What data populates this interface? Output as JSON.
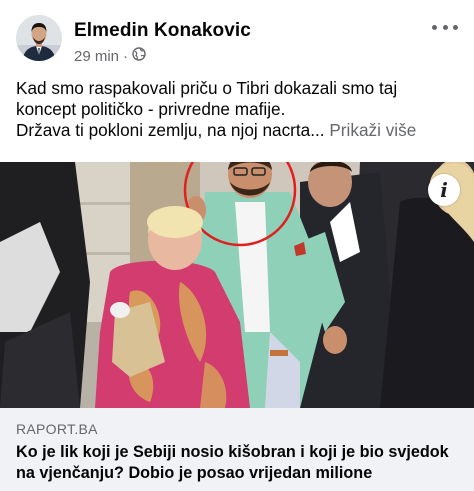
{
  "post": {
    "author": "Elmedin Konakovic",
    "time": "29 min",
    "separator": "·",
    "audience_icon": "globe-icon",
    "more_icon": "more-horizontal-icon",
    "text_lines": [
      "Kad smo raspakovali priču o Tibri dokazali smo taj",
      "koncept političko - privredne mafije.",
      "Država ti pokloni zemlju, na njoj nacrta..."
    ],
    "see_more": "Prikaži više"
  },
  "link_preview": {
    "domain": "RAPORT.BA",
    "title_lines": [
      "Ko je lik koji je Sebiji nosio kišobran i koji je bio svjedok",
      "na vjenčanju? Dobio je posao vrijedan milione"
    ],
    "info_label": "i",
    "highlight_color": "#e02020"
  },
  "colors": {
    "text_primary": "#050505",
    "text_secondary": "#65676b",
    "link_box_bg": "#f0f2f5"
  }
}
